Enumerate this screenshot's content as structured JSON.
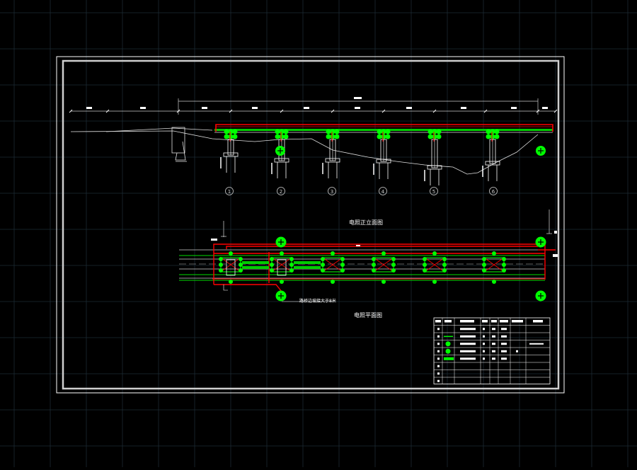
{
  "drawing": {
    "elevation_title": "电照正立面图",
    "plan_title": "电照平面图",
    "plan_note": "路桥边坡接大于8米",
    "pier_labels": [
      "1",
      "2",
      "3",
      "4",
      "5",
      "6"
    ]
  },
  "colors": {
    "background": "#000000",
    "grid": "#1c2a33",
    "frame": "#ffffff",
    "lighting": "#00ff00",
    "cable": "#ff0000",
    "structure": "#ffffff"
  },
  "legend": {
    "rows": 8,
    "symbols": [
      "dot",
      "dash",
      "lamp",
      "lamp",
      "bar",
      "dot",
      "dot",
      "dot"
    ]
  }
}
